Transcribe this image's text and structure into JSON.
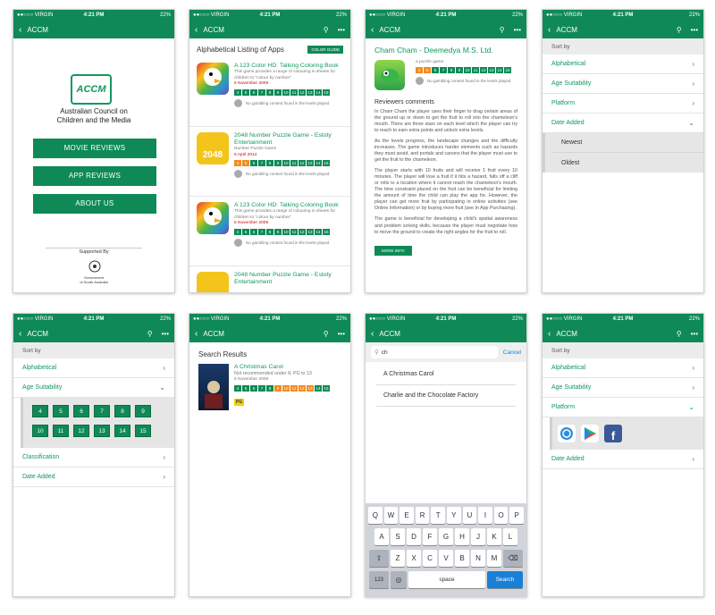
{
  "status": {
    "carrier": "●●○○○ VIRGIN",
    "time": "4:21 PM",
    "battery": "22%"
  },
  "brand": "ACCM",
  "home": {
    "logo": "ACCM",
    "org": [
      "Australian Council on",
      "Children and the Media"
    ],
    "buttons": [
      "MOVIE REVIEWS",
      "APP REVIEWS",
      "ABOUT US"
    ],
    "supported": "Supported By",
    "gov": [
      "Government",
      "of South Australia"
    ]
  },
  "list": {
    "title": "Alphabetical Listing of Apps",
    "color_guide": "COLOR GUIDE",
    "apps": [
      {
        "title": "A 123 Color HD: Talking Coloring Book",
        "desc": "This game provides a range of colouring in sheets for children to \"colour by number\"",
        "date": "5 November 2009",
        "gamble": "No gambling content found in the levels played"
      },
      {
        "title": "2048 Number Puzzle Game - Estoty Entertainment",
        "desc": "Number Puzzle Game",
        "date": "6 April 2014",
        "gamble": "No gambling content found in the levels played"
      },
      {
        "title": "A 123 Color HD: Talking Coloring Book",
        "desc": "This game provides a range of colouring in sheets for children to \"colour by number\"",
        "date": "5 November 2009",
        "gamble": "No gambling content found in the levels played"
      },
      {
        "title": "2048 Number Puzzle Game - Estoty Entertainment",
        "desc": "",
        "date": "",
        "gamble": ""
      }
    ],
    "ages": [
      "4",
      "5",
      "6",
      "7",
      "8",
      "9",
      "10",
      "11",
      "12",
      "13",
      "14",
      "15"
    ]
  },
  "detail": {
    "title": "Cham Cham - Deemedya M.S. Ltd.",
    "sub": "a puzzle game",
    "gamble": "No gambling content found in the levels played",
    "heading": "Reviewers comments",
    "paras": [
      "In Cham Cham the player uses their finger to drag certain areas of the ground up or down to get the fruit to roll into the chameleon's mouth. There are three stars on each level which the player can try to reach to earn extra points and unlock extra levels.",
      "As the levels progress, the landscape changes and the difficulty increases. The game introduces harder elements such as hazards they must avoid, and portals and canons that the player must use to get the fruit to the chameleon.",
      "The player starts with 10 fruits and will receive 1 fruit every 10 minutes. The player will lose a fruit if it hits a hazard, falls off a cliff or rolls to a location where it cannot reach the chameleon's mouth. The time constraint placed on the fruit can be beneficial for limiting the amount of time the child can play the app for. However, the player can get more fruit by participating in online activities (see Online Information) or by buying more fruit (see In App Purchasing).",
      "The game is beneficial for developing a child's spatial awareness and problem solving skills, because the player must negotiate how to move the ground to create the right angles for the fruit to roll."
    ],
    "more": "MORE INFO"
  },
  "sort": {
    "label": "Sort by",
    "alpha": "Alphabetical",
    "age": "Age Suitability",
    "platform": "Platform",
    "date": "Date Added",
    "newest": "Newest",
    "oldest": "Oldest",
    "classification": "Classification"
  },
  "ages": [
    "4",
    "5",
    "6",
    "7",
    "8",
    "9",
    "10",
    "11",
    "12",
    "13",
    "14",
    "15"
  ],
  "search": {
    "heading": "Search Results",
    "title": "A Christmas Carol",
    "note": "Not recommended under 8, PG to 13",
    "date": "5 November 2009",
    "rating": "PG",
    "query": "ch",
    "cancel": "Cancel",
    "sugs": [
      "A Christmas Carol",
      "Charlie and the Chocolate Factory"
    ]
  },
  "kb": {
    "r1": [
      "Q",
      "W",
      "E",
      "R",
      "T",
      "Y",
      "U",
      "I",
      "O",
      "P"
    ],
    "r2": [
      "A",
      "S",
      "D",
      "F",
      "G",
      "H",
      "J",
      "K",
      "L"
    ],
    "r3": [
      "Z",
      "X",
      "C",
      "V",
      "B",
      "N",
      "M"
    ],
    "n": "123",
    "space": "space",
    "go": "Search"
  }
}
